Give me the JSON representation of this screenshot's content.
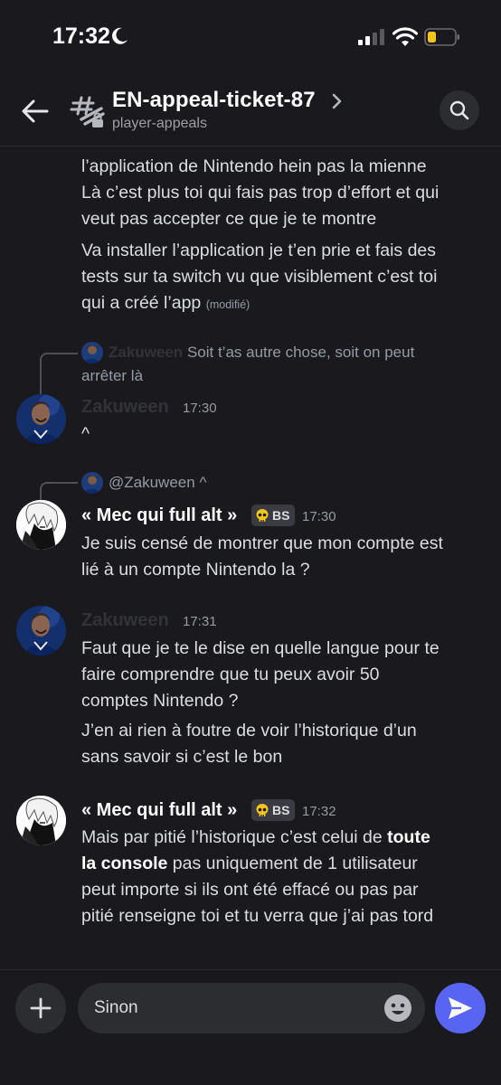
{
  "status_bar": {
    "time": "17:32"
  },
  "header": {
    "title": "EN-appeal-ticket-87",
    "subtitle": "player-appeals"
  },
  "messages": {
    "m1_lines": [
      "l’application de Nintendo hein pas la mienne",
      "Là c’est plus toi qui fais pas trop d’effort et qui",
      "veut pas accepter ce que je te montre"
    ],
    "m2_lines": [
      "Va installer l’application je t’en prie et fais des",
      "tests sur ta switch vu que visiblement c’est toi",
      "qui a créé l’app"
    ],
    "m2_edited": "(modifié)",
    "reply1": {
      "name": "Zakuween",
      "text_line1": "Soit t’as autre chose, soit on peut",
      "text_line2": "arrêter là"
    },
    "m3": {
      "author": "Zakuween",
      "time": "17:30",
      "text": "^"
    },
    "reply2": {
      "name": "@Zakuween",
      "text": "^"
    },
    "m4": {
      "author": "« Mec qui full alt »",
      "tag": "BS",
      "time": "17:30",
      "lines": [
        "Je suis censé de montrer que mon compte est",
        "lié à un compte Nintendo la ?"
      ]
    },
    "m5": {
      "author": "Zakuween",
      "time": "17:31",
      "lines": [
        "Faut que je te le dise en quelle langue pour te",
        "faire comprendre que tu peux avoir 50",
        "comptes Nintendo ?"
      ],
      "lines2": [
        "J’en ai rien à foutre de voir l’historique d’un",
        "sans savoir si c’est le bon"
      ]
    },
    "m6": {
      "author": "« Mec qui full alt »",
      "tag": "BS",
      "time": "17:32",
      "l1_pre": "Mais par pitié l’historique c’est celui de ",
      "l1_bold": "toute",
      "l2_bold": "la console",
      "l2_post": " pas uniquement de 1 utilisateur",
      "l3": "peut importe si ils ont été effacé ou pas par",
      "l4": "pitié renseigne toi et tu verra que j’ai pas tord"
    }
  },
  "composer": {
    "value": "Sinon",
    "placeholder": ""
  },
  "colors": {
    "accent": "#5865f2",
    "background": "#1a1a1e",
    "battery": "#f5c518"
  },
  "icons": [
    "moon-icon",
    "signal-icon",
    "wifi-icon",
    "battery-icon",
    "back-arrow-icon",
    "thread-icon",
    "chevron-right-icon",
    "search-icon",
    "skull-icon",
    "plus-icon",
    "emoji-icon",
    "send-icon"
  ]
}
